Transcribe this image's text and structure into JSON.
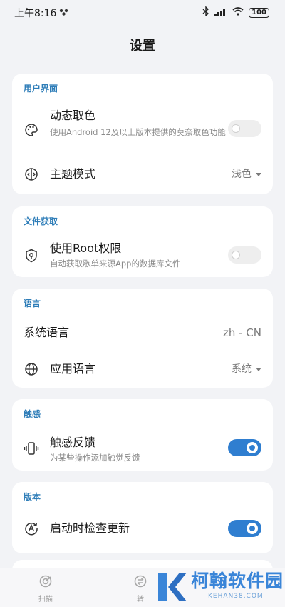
{
  "status": {
    "time": "上午8:16",
    "battery": "100"
  },
  "page": {
    "title": "设置"
  },
  "sections": {
    "ui": {
      "header": "用户界面",
      "dynamic_color": {
        "title": "动态取色",
        "subtitle": "使用Android 12及以上版本提供的莫奈取色功能",
        "enabled": false
      },
      "theme_mode": {
        "title": "主题模式",
        "value": "浅色"
      }
    },
    "file": {
      "header": "文件获取",
      "root": {
        "title": "使用Root权限",
        "subtitle": "自动获取歌单来源App的数据库文件",
        "enabled": false
      }
    },
    "language": {
      "header": "语言",
      "system_language": {
        "title": "系统语言",
        "value": "zh - CN"
      },
      "app_language": {
        "title": "应用语言",
        "value": "系统"
      }
    },
    "haptic": {
      "header": "触感",
      "feedback": {
        "title": "触感反馈",
        "subtitle": "为某些操作添加触觉反馈",
        "enabled": true
      }
    },
    "version": {
      "header": "版本",
      "check_update": {
        "title": "启动时检查更新",
        "enabled": true
      }
    }
  },
  "bottom_nav": {
    "scan": "扫描",
    "convert": "转"
  },
  "watermark": {
    "name": "柯翰软件园",
    "url": "KEHAN38.COM"
  },
  "colors": {
    "accent": "#2f7ed0",
    "section_header": "#2e7db8",
    "background": "#f2f3f6"
  }
}
